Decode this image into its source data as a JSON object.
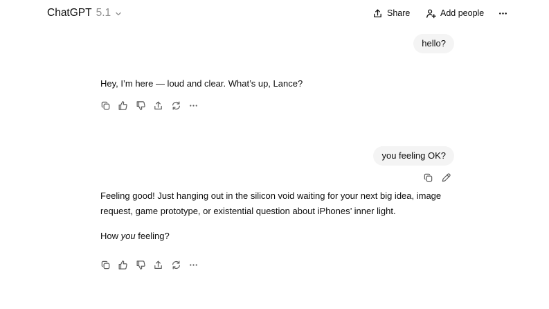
{
  "header": {
    "model_name": "ChatGPT",
    "model_version": "5.1",
    "share_label": "Share",
    "add_people_label": "Add people"
  },
  "messages": [
    {
      "role": "user",
      "text": "hello?"
    },
    {
      "role": "assistant",
      "text": "Hey, I’m here — loud and clear. What’s up, Lance?"
    },
    {
      "role": "user",
      "text": "you feeling OK?"
    },
    {
      "role": "assistant",
      "paragraph1": "Feeling good! Just hanging out in the silicon void waiting for your next big idea, image request, game prototype, or existential question about iPhones’ inner light.",
      "paragraph2_before": "How ",
      "paragraph2_emphasis": "you",
      "paragraph2_after": " feeling?"
    }
  ],
  "assistant_actions": [
    "copy-icon",
    "thumbs-up-icon",
    "thumbs-down-icon",
    "share-icon",
    "regenerate-icon",
    "more-icon"
  ],
  "user_actions": [
    "copy-icon",
    "edit-icon"
  ],
  "colors": {
    "background": "#ffffff",
    "text": "#0d0d0d",
    "muted": "#8f8f8f",
    "bubble": "#f4f4f4",
    "icon": "#5d5d5d"
  }
}
